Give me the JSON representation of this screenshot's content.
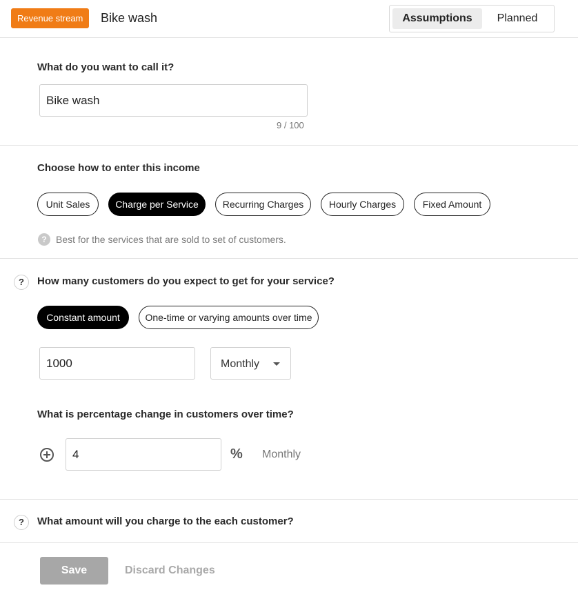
{
  "header": {
    "badge": "Revenue stream",
    "title": "Bike wash",
    "tabs": [
      {
        "label": "Assumptions",
        "active": true
      },
      {
        "label": "Planned",
        "active": false
      }
    ]
  },
  "name_section": {
    "question": "What do you want to call it?",
    "value": "Bike wash",
    "counter": "9 / 100"
  },
  "income_section": {
    "question": "Choose how to enter this income",
    "options": [
      "Unit Sales",
      "Charge per Service",
      "Recurring Charges",
      "Hourly Charges",
      "Fixed Amount"
    ],
    "selected": "Charge per Service",
    "hint": "Best for the services that are sold to set of customers."
  },
  "customers_section": {
    "question": "How many customers do you expect to get for your service?",
    "modes": [
      "Constant amount",
      "One-time or varying amounts over time"
    ],
    "selected_mode": "Constant amount",
    "amount": "1000",
    "period": "Monthly",
    "change_question": "What is percentage change in customers over time?",
    "change_value": "4",
    "change_period": "Monthly"
  },
  "charge_section": {
    "question": "What amount will you charge to the each customer?"
  },
  "footer": {
    "save_label": "Save",
    "discard_label": "Discard Changes"
  },
  "colors": {
    "accent": "#f07c16",
    "selected_pill": "#000000",
    "save_disabled": "#a7a7a7"
  },
  "icons": [
    "help-icon",
    "plus-circle-icon",
    "percent-icon",
    "chevron-down-icon"
  ]
}
